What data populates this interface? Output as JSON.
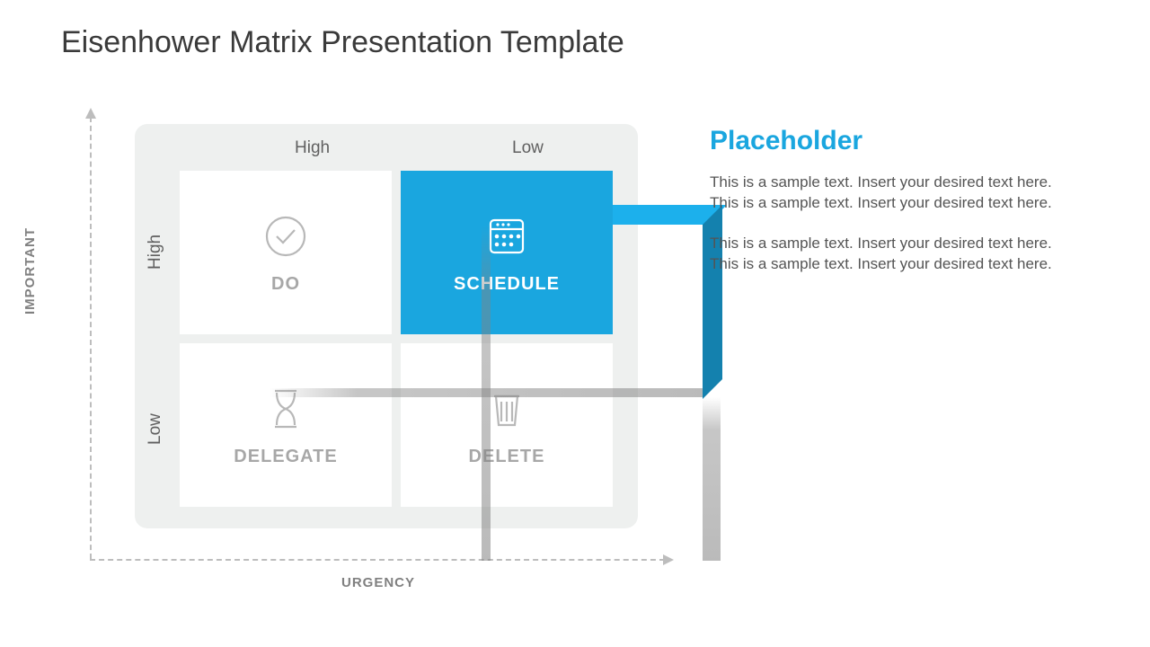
{
  "title": "Eisenhower Matrix Presentation Template",
  "axes": {
    "y": "IMPORTANT",
    "x": "URGENCY"
  },
  "cols": [
    "High",
    "Low"
  ],
  "rows": [
    "High",
    "Low"
  ],
  "quadrants": {
    "q1": {
      "label": "DO",
      "icon": "check-circle-icon"
    },
    "q2": {
      "label": "SCHEDULE",
      "icon": "calendar-icon"
    },
    "q3": {
      "label": "DELEGATE",
      "icon": "hourglass-icon"
    },
    "q4": {
      "label": "DELETE",
      "icon": "trash-icon"
    }
  },
  "highlighted": "q2",
  "accent_color": "#1aa6df",
  "sidebar": {
    "heading": "Placeholder",
    "p1": "This is a sample text. Insert your desired text here. This is a sample text. Insert your desired text here.",
    "p2": "This is a sample text. Insert your desired text here. This is a sample text. Insert your desired text here."
  },
  "chart_data": {
    "type": "table",
    "title": "Eisenhower Matrix",
    "xlabel": "URGENCY",
    "ylabel": "IMPORTANT",
    "x_categories": [
      "High",
      "Low"
    ],
    "y_categories": [
      "High",
      "Low"
    ],
    "cells": [
      {
        "importance": "High",
        "urgency": "High",
        "action": "DO"
      },
      {
        "importance": "High",
        "urgency": "Low",
        "action": "SCHEDULE"
      },
      {
        "importance": "Low",
        "urgency": "High",
        "action": "DELEGATE"
      },
      {
        "importance": "Low",
        "urgency": "Low",
        "action": "DELETE"
      }
    ],
    "highlighted_cell": {
      "importance": "High",
      "urgency": "Low",
      "action": "SCHEDULE"
    }
  }
}
